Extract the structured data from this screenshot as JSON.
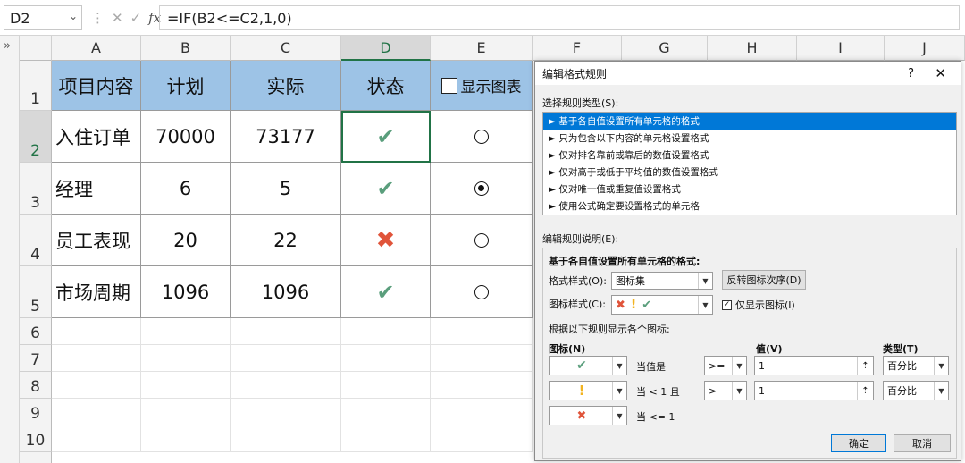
{
  "formula_bar": {
    "name_box": "D2",
    "formula": "=IF(B2<=C2,1,0)",
    "fx": "fx",
    "collapse": "»"
  },
  "columns": [
    "A",
    "B",
    "C",
    "D",
    "E",
    "F",
    "G",
    "H",
    "I",
    "J"
  ],
  "rows": [
    "1",
    "2",
    "3",
    "4",
    "5",
    "6",
    "7",
    "8",
    "9",
    "10"
  ],
  "header_row": {
    "a": "项目内容",
    "b": "计划",
    "c": "实际",
    "d": "状态",
    "e": "显示图表"
  },
  "data_rows": [
    {
      "a": "入住订单",
      "b": "70000",
      "c": "73177",
      "status": "check",
      "radio": false
    },
    {
      "a": "经理",
      "b": "6",
      "c": "5",
      "status": "check",
      "radio": true
    },
    {
      "a": "员工表现",
      "b": "20",
      "c": "22",
      "status": "cross",
      "radio": false
    },
    {
      "a": "市场周期",
      "b": "1096",
      "c": "1096",
      "status": "check",
      "radio": false
    }
  ],
  "colors": {
    "header_fill": "#9dc3e6",
    "check": "#5a9e7c",
    "cross": "#e0543a",
    "warn": "#f2b320",
    "accent": "#217346",
    "select": "#0078d7"
  },
  "dialog": {
    "title": "编辑格式规则",
    "help": "?",
    "close": "✕",
    "rule_type_label": "选择规则类型(S):",
    "rule_types": [
      "► 基于各自值设置所有单元格的格式",
      "► 只为包含以下内容的单元格设置格式",
      "► 仅对排名靠前或靠后的数值设置格式",
      "► 仅对高于或低于平均值的数值设置格式",
      "► 仅对唯一值或重复值设置格式",
      "► 使用公式确定要设置格式的单元格"
    ],
    "edit_label": "编辑规则说明(E):",
    "desc_heading": "基于各自值设置所有单元格的格式:",
    "format_style_label": "格式样式(O):",
    "format_style_value": "图标集",
    "reverse_button": "反转图标次序(D)",
    "icon_style_label": "图标样式(C):",
    "show_icon_only": "仅显示图标(I)",
    "rules_caption": "根据以下规则显示各个图标:",
    "col_icon": "图标(N)",
    "col_value": "值(V)",
    "col_type": "类型(T)",
    "icon_rules": [
      {
        "icon": "check",
        "cond": "当值是",
        "op": ">=",
        "value": "1",
        "type": "百分比"
      },
      {
        "icon": "warn",
        "cond": "当 < 1 且",
        "op": ">",
        "value": "1",
        "type": "百分比"
      },
      {
        "icon": "cross",
        "cond": "当 <= 1",
        "op": "",
        "value": "",
        "type": ""
      }
    ],
    "ok": "确定",
    "cancel": "取消"
  }
}
